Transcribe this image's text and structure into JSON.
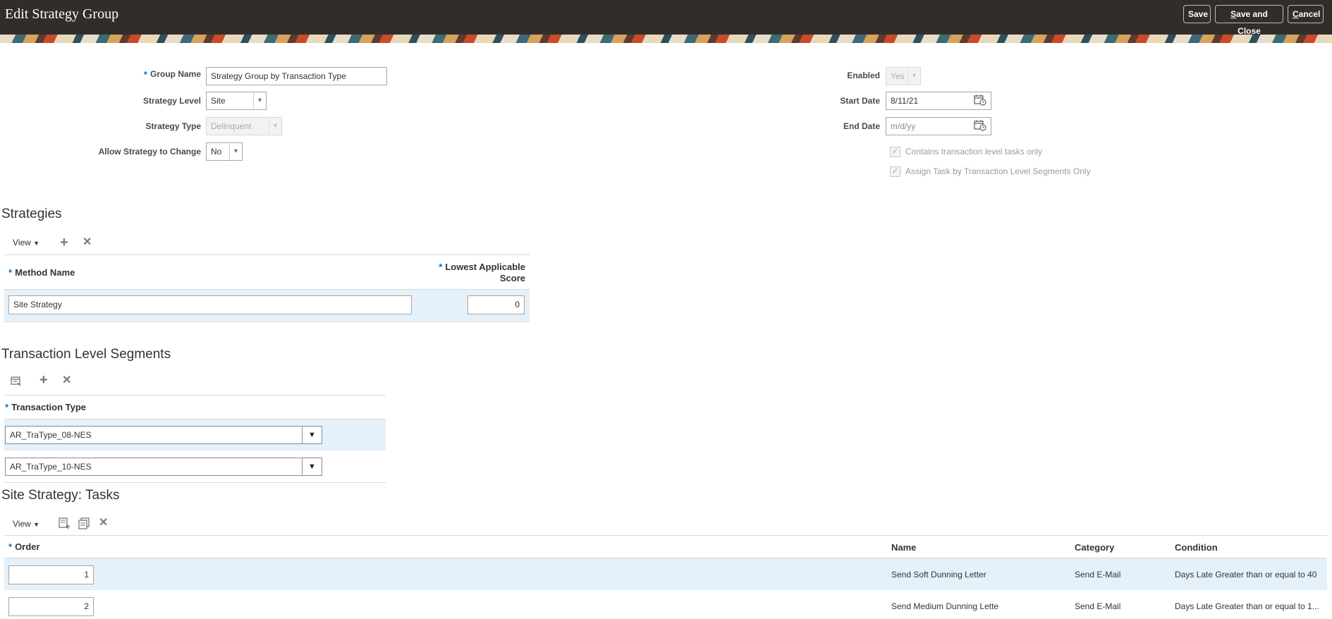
{
  "header": {
    "title": "Edit Strategy Group",
    "save_label": "Save",
    "save_close_prefix": "S",
    "save_close_rest": "ave and Close",
    "cancel_prefix": "C",
    "cancel_rest": "ancel"
  },
  "form": {
    "required_mark": "*",
    "group_name_label": "Group Name",
    "group_name_value": "Strategy Group by Transaction Type",
    "strategy_level_label": "Strategy Level",
    "strategy_level_value": "Site",
    "strategy_type_label": "Strategy Type",
    "strategy_type_value": "Delinquent",
    "allow_change_label": "Allow Strategy to Change",
    "allow_change_value": "No",
    "enabled_label": "Enabled",
    "enabled_value": "Yes",
    "start_date_label": "Start Date",
    "start_date_value": "8/11/21",
    "end_date_label": "End Date",
    "end_date_placeholder": "m/d/yy",
    "contains_tx_label": "Contains transaction level tasks only",
    "assign_task_label": "Assign Task by Transaction Level Segments Only"
  },
  "strategies": {
    "title": "Strategies",
    "view_label": "View",
    "col_method": "Method Name",
    "col_score_line1": "Lowest Applicable",
    "col_score_line2": "Score",
    "rows": [
      {
        "method": "Site Strategy",
        "score": "0"
      }
    ]
  },
  "segments": {
    "title": "Transaction Level Segments",
    "col_type": "Transaction Type",
    "rows": [
      {
        "type": "AR_TraType_08-NES"
      },
      {
        "type": "AR_TraType_10-NES"
      }
    ]
  },
  "tasks": {
    "title": "Site Strategy: Tasks",
    "view_label": "View",
    "col_order": "Order",
    "col_name": "Name",
    "col_category": "Category",
    "col_condition": "Condition",
    "rows": [
      {
        "order": "1",
        "name": "Send Soft Dunning Letter",
        "category": "Send E-Mail",
        "condition": "Days Late Greater than or equal to 40"
      },
      {
        "order": "2",
        "name": "Send Medium Dunning Lette",
        "category": "Send E-Mail",
        "condition": "Days Late Greater than or equal to 1..."
      }
    ]
  },
  "icons": {
    "dropdown": "▾",
    "view_caret": "▼",
    "add": "+",
    "delete": "✕",
    "check": "✓"
  }
}
